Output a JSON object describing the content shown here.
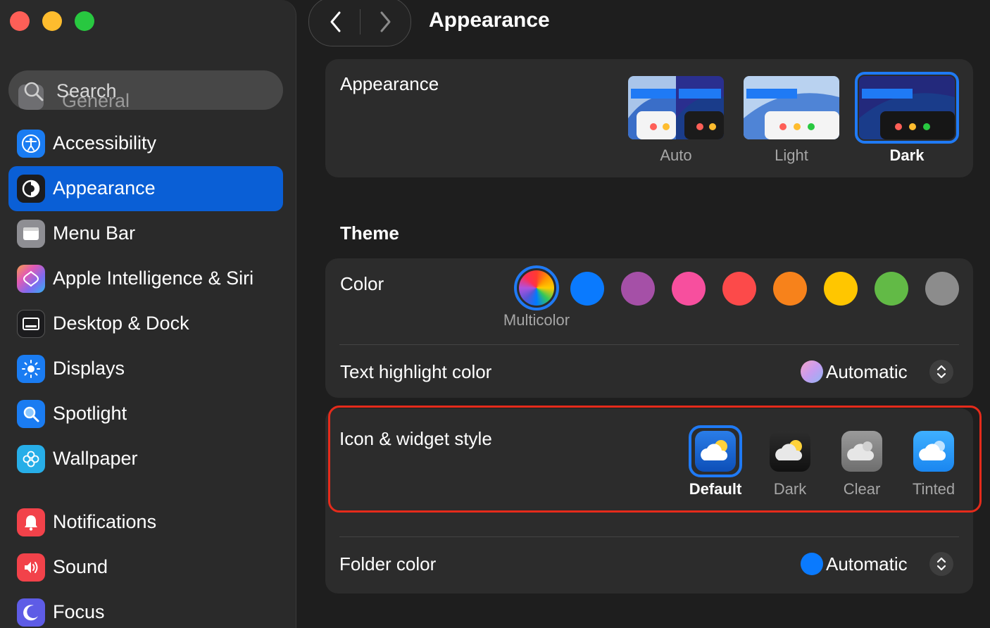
{
  "window": {
    "title": "Appearance"
  },
  "search": {
    "placeholder": "Search",
    "hidden_item": "General"
  },
  "sidebar": {
    "items": [
      {
        "label": "Accessibility",
        "icon": "accessibility-icon",
        "color": "#1a7cf2"
      },
      {
        "label": "Appearance",
        "icon": "appearance-icon",
        "color": "#1c1c1e",
        "active": true
      },
      {
        "label": "Menu Bar",
        "icon": "menu-bar-icon",
        "color": "#8e8e93"
      },
      {
        "label": "Apple Intelligence & Siri",
        "icon": "siri-icon",
        "color": "#c86ad9"
      },
      {
        "label": "Desktop & Dock",
        "icon": "dock-icon",
        "color": "#1c1c1e"
      },
      {
        "label": "Displays",
        "icon": "displays-icon",
        "color": "#1a7cf2"
      },
      {
        "label": "Spotlight",
        "icon": "spotlight-icon",
        "color": "#1a7cf2"
      },
      {
        "label": "Wallpaper",
        "icon": "wallpaper-icon",
        "color": "#27aee8"
      },
      {
        "label": "Notifications",
        "icon": "bell-icon",
        "color": "#f2424a"
      },
      {
        "label": "Sound",
        "icon": "speaker-icon",
        "color": "#f2424a"
      },
      {
        "label": "Focus",
        "icon": "moon-icon",
        "color": "#5e5ce6"
      }
    ]
  },
  "appearance": {
    "label": "Appearance",
    "options": [
      {
        "label": "Auto",
        "selected": false
      },
      {
        "label": "Light",
        "selected": false
      },
      {
        "label": "Dark",
        "selected": true
      }
    ]
  },
  "theme": {
    "title": "Theme",
    "color_label": "Color",
    "selected_color": "Multicolor",
    "colors": [
      "multicolor",
      "#0a7afe",
      "#a550a7",
      "#f74f9e",
      "#fc4a4a",
      "#f7821b",
      "#ffc600",
      "#62ba46",
      "#8c8c8c"
    ],
    "highlight_label": "Text highlight color",
    "highlight_value": "Automatic"
  },
  "icon_style": {
    "label": "Icon & widget style",
    "options": [
      {
        "label": "Default",
        "selected": true
      },
      {
        "label": "Dark",
        "selected": false
      },
      {
        "label": "Clear",
        "selected": false
      },
      {
        "label": "Tinted",
        "selected": false
      }
    ]
  },
  "folder": {
    "label": "Folder color",
    "value": "Automatic",
    "color": "#0a7afe"
  }
}
